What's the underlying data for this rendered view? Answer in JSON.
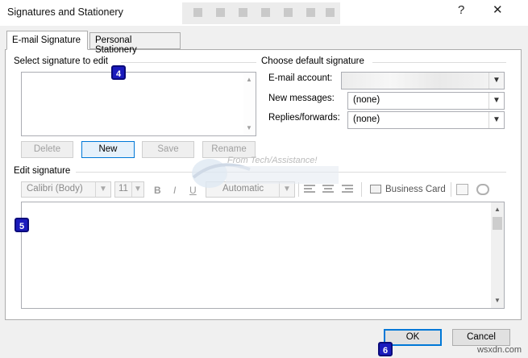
{
  "window": {
    "title": "Signatures and Stationery",
    "help": "?",
    "close": "✕"
  },
  "tabs": [
    {
      "label": "E-mail Signature",
      "active": true
    },
    {
      "label": "Personal Stationery",
      "active": false
    }
  ],
  "select_signature": {
    "heading": "Select signature to edit",
    "badge": "4"
  },
  "signature_buttons": {
    "delete": "Delete",
    "new": "New",
    "save": "Save",
    "rename": "Rename"
  },
  "default_signature": {
    "heading": "Choose default signature",
    "email_account_label": "E-mail account:",
    "new_messages_label": "New messages:",
    "new_messages_value": "(none)",
    "replies_label": "Replies/forwards:",
    "replies_value": "(none)"
  },
  "edit_signature": {
    "heading": "Edit signature",
    "font": "Calibri (Body)",
    "size": "11",
    "bold": "B",
    "italic": "I",
    "underline": "U",
    "color": "Automatic",
    "business_card": "Business Card",
    "badge": "5"
  },
  "watermark": {
    "text": "From Tech/Assistance!"
  },
  "footer": {
    "ok": "OK",
    "cancel": "Cancel",
    "badge": "6",
    "site": "wsxdn.com"
  },
  "colors": {
    "badge_blue": "#1b1bbd",
    "focus_blue": "#0078d7"
  }
}
